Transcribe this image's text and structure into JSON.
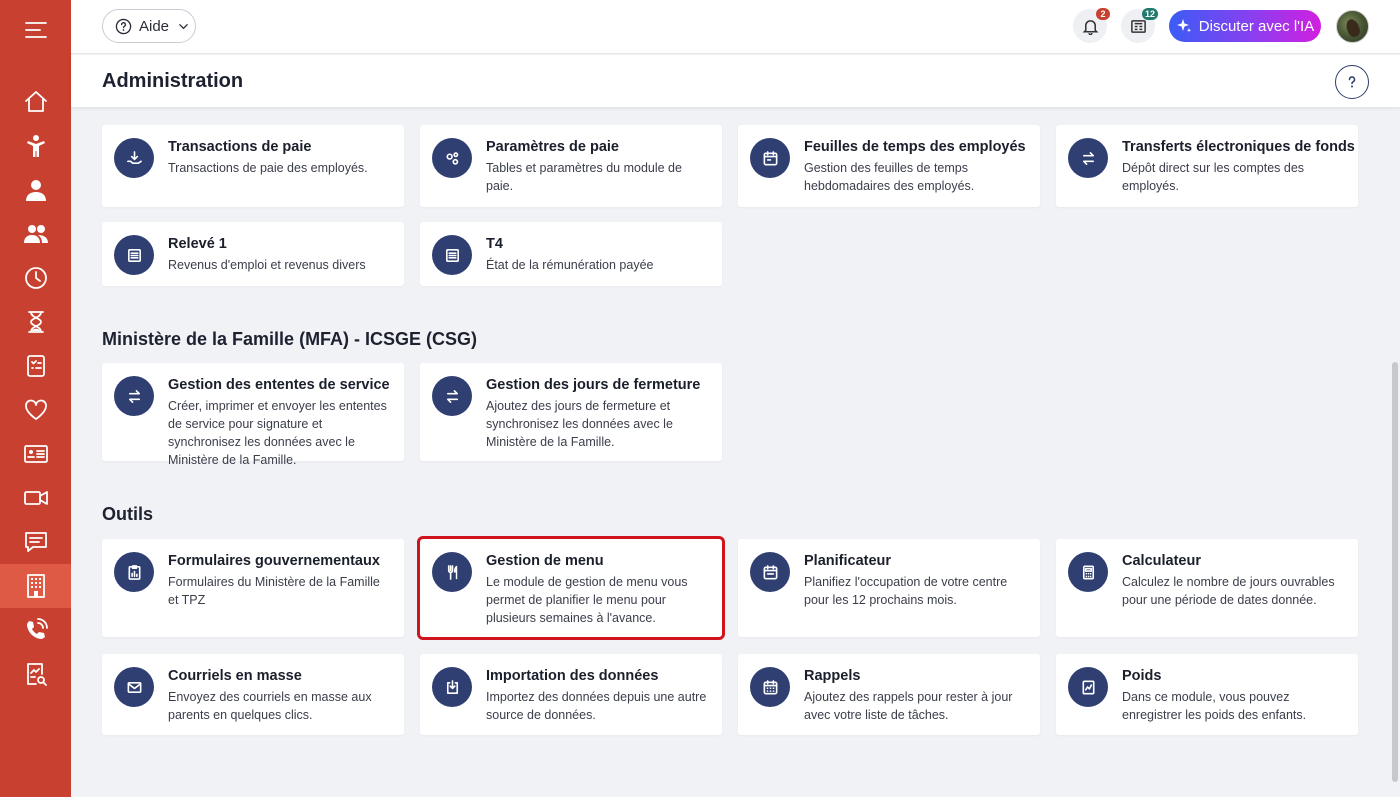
{
  "topbar": {
    "help_label": "Aide",
    "notifications_count": "2",
    "news_count": "12",
    "ai_label": "Discuter avec l'IA"
  },
  "header": {
    "title": "Administration"
  },
  "sections": {
    "payroll": {
      "cards": [
        {
          "title": "Transactions de paie",
          "desc": "Transactions de paie des employés."
        },
        {
          "title": "Paramètres de paie",
          "desc": "Tables et paramètres du module de paie."
        },
        {
          "title": "Feuilles de temps des employés",
          "desc": "Gestion des feuilles de temps hebdomadaires des employés."
        },
        {
          "title": "Transferts électroniques de fonds",
          "desc": "Dépôt direct sur les comptes des employés."
        },
        {
          "title": "Relevé 1",
          "desc": "Revenus d'emploi et revenus divers"
        },
        {
          "title": "T4",
          "desc": "État de la rémunération payée"
        }
      ]
    },
    "mfa": {
      "title": "Ministère de la Famille (MFA) - ICSGE (CSG)",
      "cards": [
        {
          "title": "Gestion des ententes de service",
          "desc": "Créer, imprimer et envoyer les ententes de service pour signature et synchronisez les données avec le Ministère de la Famille."
        },
        {
          "title": "Gestion des jours de fermeture",
          "desc": "Ajoutez des jours de fermeture et synchronisez les données avec le Ministère de la Famille."
        }
      ]
    },
    "tools": {
      "title": "Outils",
      "cards": [
        {
          "title": "Formulaires gouvernementaux",
          "desc": "Formulaires du Ministère de la Famille et TPZ"
        },
        {
          "title": "Gestion de menu",
          "desc": "Le module de gestion de menu vous permet de planifier le menu pour plusieurs semaines à l'avance."
        },
        {
          "title": "Planificateur",
          "desc": "Planifiez l'occupation de votre centre pour les 12 prochains mois."
        },
        {
          "title": "Calculateur",
          "desc": "Calculez le nombre de jours ouvrables pour une période de dates donnée."
        },
        {
          "title": "Courriels en masse",
          "desc": "Envoyez des courriels en masse aux parents en quelques clics."
        },
        {
          "title": "Importation des données",
          "desc": "Importez des données depuis une autre source de données."
        },
        {
          "title": "Rappels",
          "desc": "Ajoutez des rappels pour rester à jour avec votre liste de tâches."
        },
        {
          "title": "Poids",
          "desc": "Dans ce module, vous pouvez enregistrer les poids des enfants."
        }
      ]
    }
  },
  "colors": {
    "sidebar": "#c8402f",
    "sidebar_active": "#de5a45",
    "icon_circle": "#2f3f72",
    "highlight": "#d1141c",
    "badge_notifications": "#c8402f",
    "badge_news": "#1f7a6e"
  }
}
